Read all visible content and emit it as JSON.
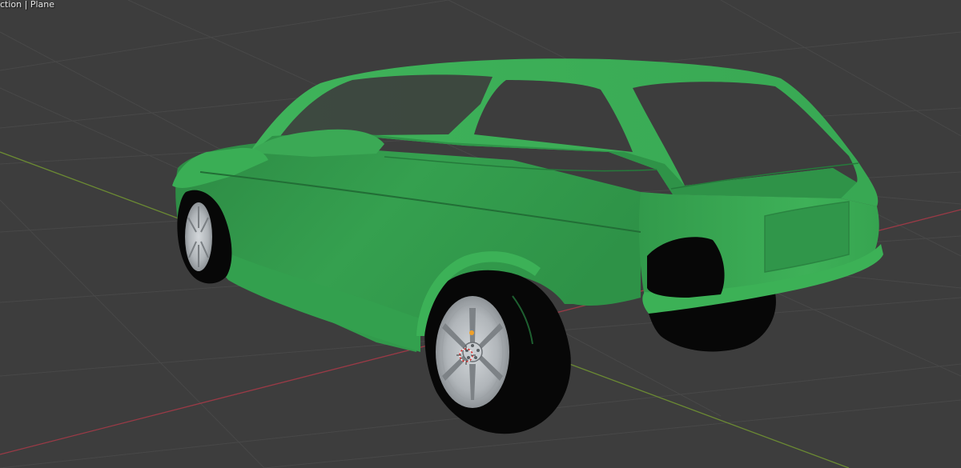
{
  "viewport": {
    "info_text": "ction | Plane",
    "background_color": "#3d3d3d",
    "grid_line_color": "#484848",
    "x_axis_color": "#9a3a46",
    "y_axis_color": "#6b8a33",
    "scene_object": "car-body-mesh",
    "object_color": "#3aa652",
    "tire_color": "#070707",
    "rim_color": "#b7bcc0",
    "origin_marker_color": "#f0a028",
    "cursor_icon": "3d-cursor-icon"
  }
}
